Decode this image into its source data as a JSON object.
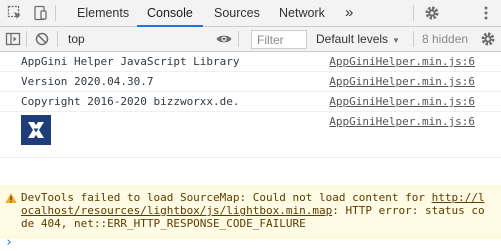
{
  "tabs": [
    {
      "label": "Elements",
      "active": false
    },
    {
      "label": "Console",
      "active": true
    },
    {
      "label": "Sources",
      "active": false
    },
    {
      "label": "Network",
      "active": false
    }
  ],
  "tabs_more": "»",
  "toolbar": {
    "context": "top",
    "filter_placeholder": "Filter",
    "levels": "Default levels",
    "hidden": "8 hidden"
  },
  "messages": [
    {
      "text": "AppGini Helper JavaScript Library",
      "source": "AppGiniHelper.min.js:6"
    },
    {
      "text": "Version 2020.04.30.7",
      "source": "AppGiniHelper.min.js:6"
    },
    {
      "text": "Copyright 2016-2020 bizzworxx.de.",
      "source": "AppGiniHelper.min.js:6"
    },
    {
      "text": "",
      "source": "AppGiniHelper.min.js:6"
    }
  ],
  "warning": {
    "prefix": "DevTools failed to load SourceMap: Could not load content for ",
    "link": "http://localhost/resources/lightbox/js/lightbox.min.map",
    "suffix": ": HTTP error: status code 404, net::ERR_HTTP_RESPONSE_CODE_FAILURE"
  },
  "prompt": "›",
  "colors": {
    "accent": "#1a73e8",
    "warning_bg": "#fffbe5",
    "warning_text": "#5c3c00",
    "logo_bg": "#1f3d7a"
  },
  "icons": [
    "inspect-icon",
    "device-toolbar-icon",
    "more-tabs-icon",
    "settings-icon",
    "menu-icon",
    "sidebar-toggle-icon",
    "clear-console-icon",
    "eye-icon",
    "console-settings-icon",
    "warning-icon",
    "logo-x-icon"
  ]
}
